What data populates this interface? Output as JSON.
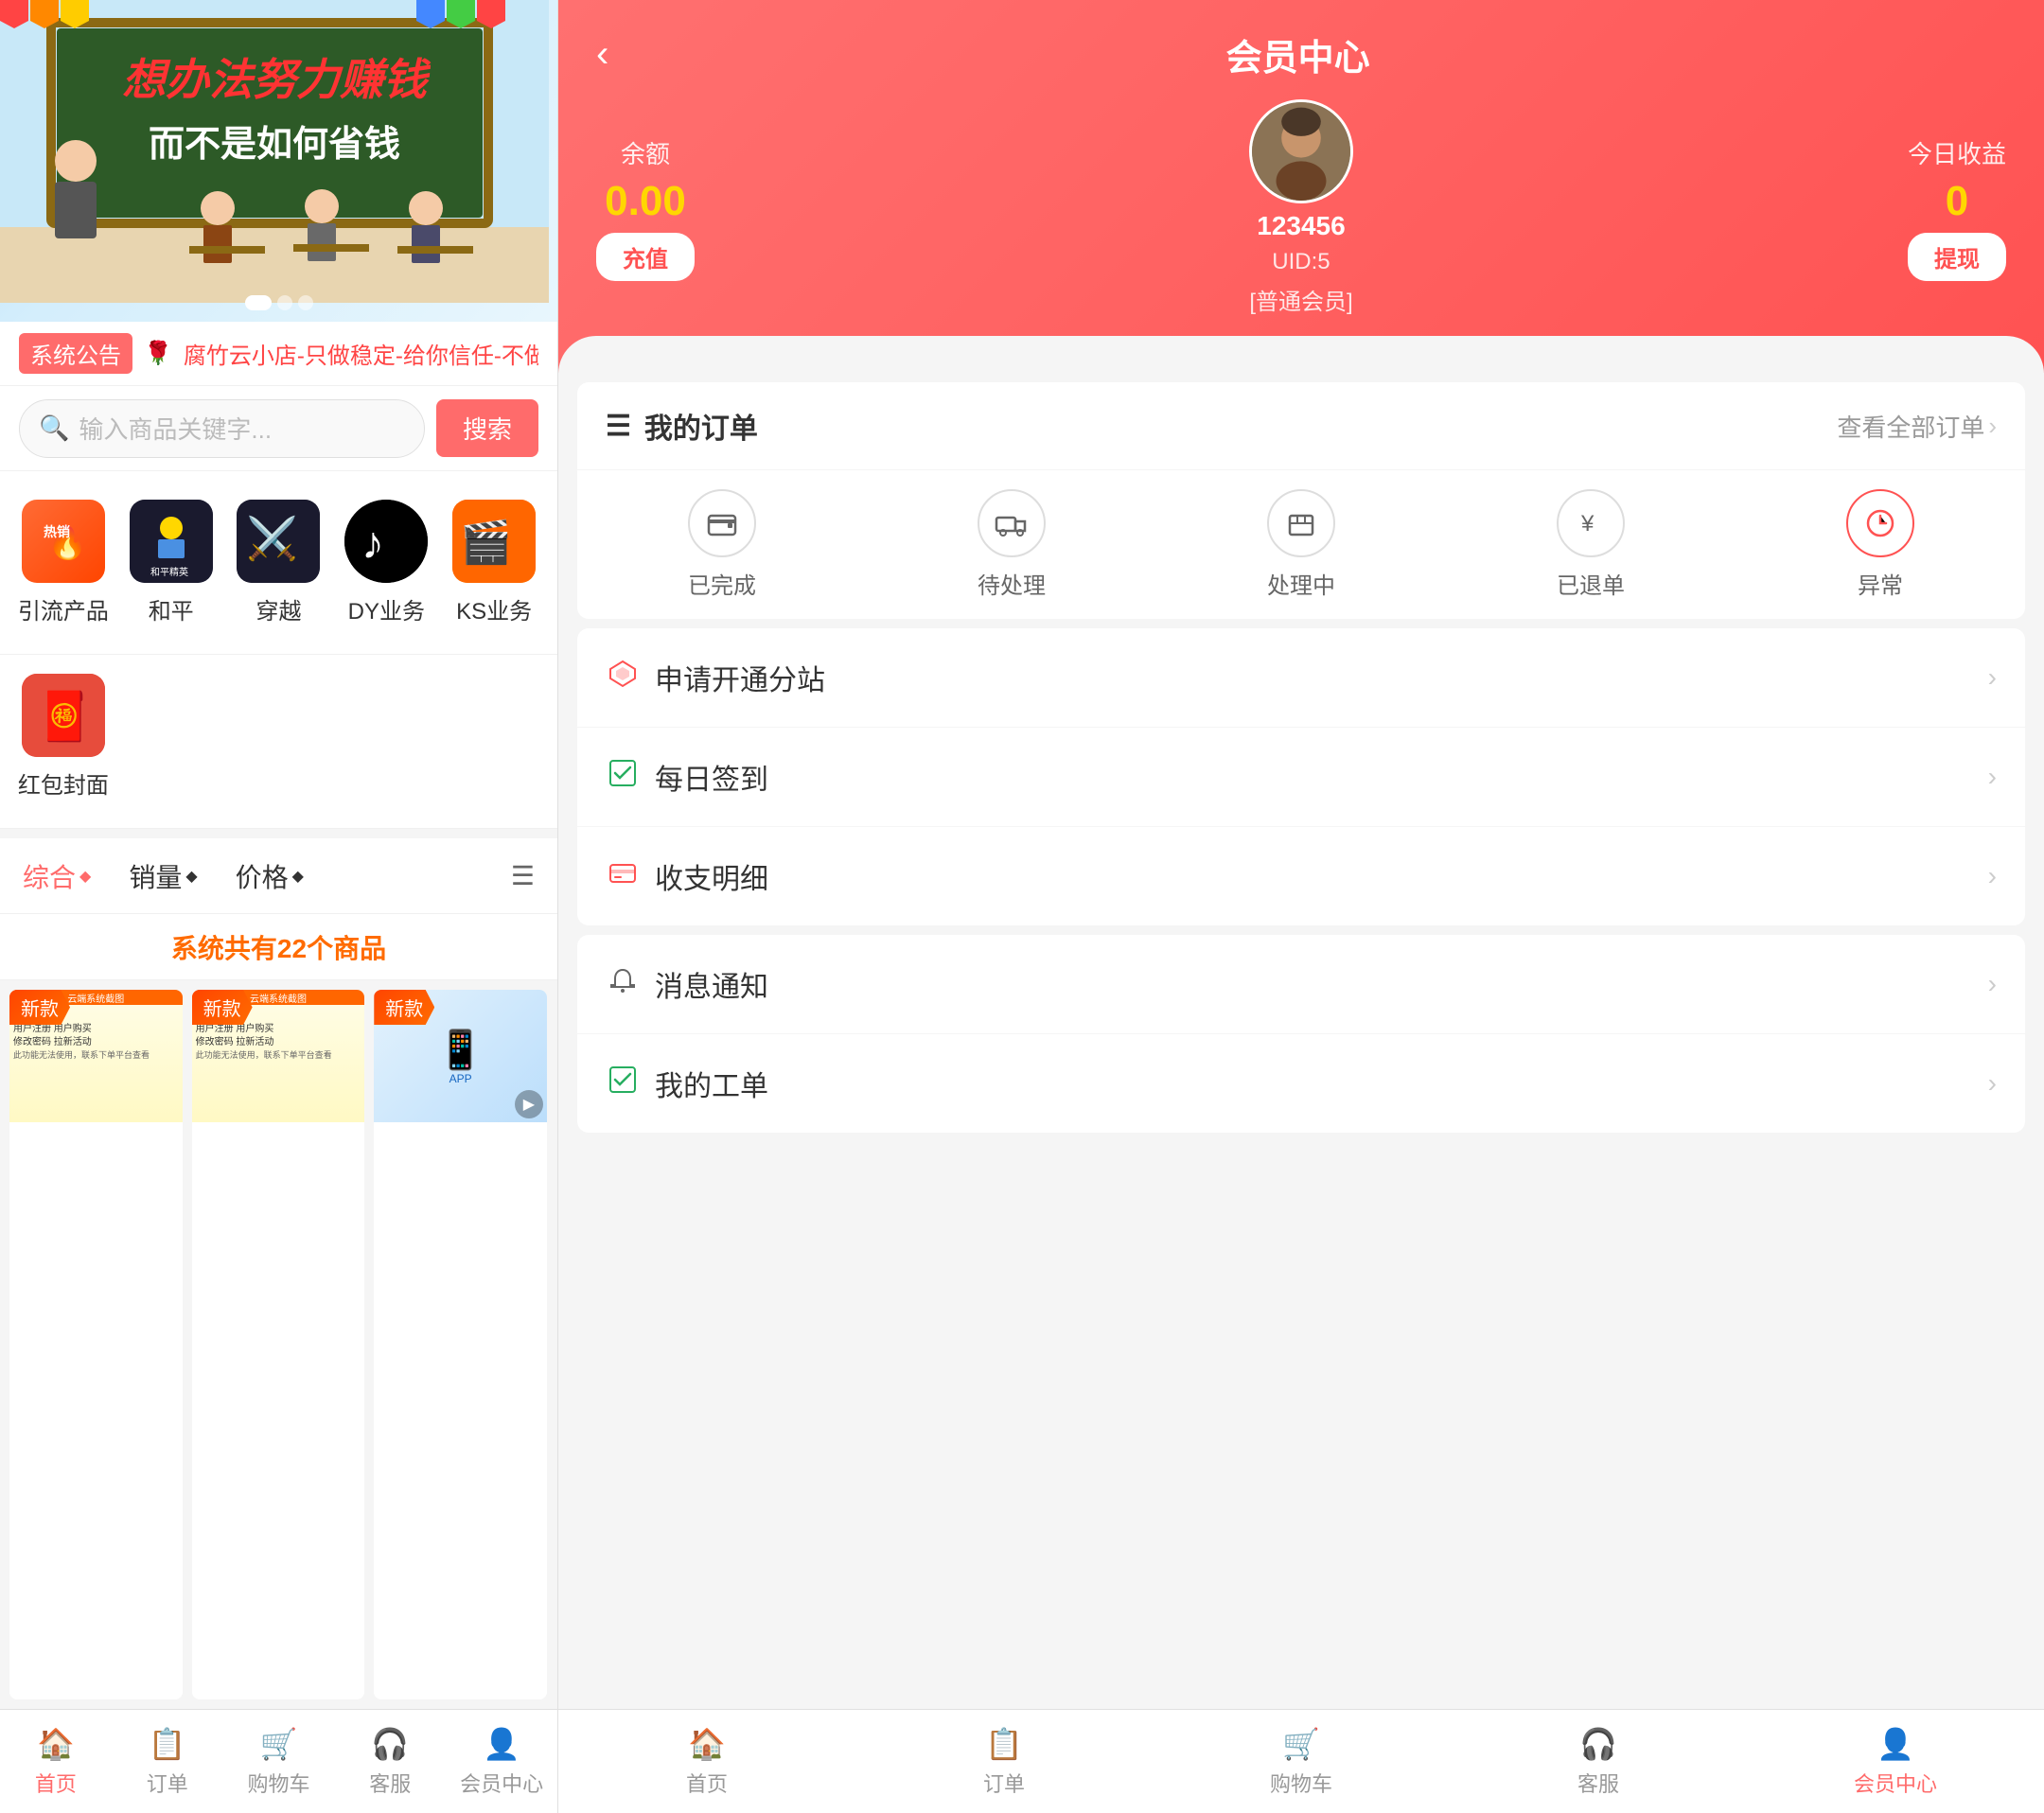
{
  "left": {
    "banner": {
      "text1": "想办法努力赚钱",
      "text2": "而不是如何省钱"
    },
    "notice": {
      "label": "系统公告",
      "text": "🌹腐竹云小店-只做稳定-给你信任-不做跑路狗-售后稳定"
    },
    "search": {
      "placeholder": "输入商品关键字...",
      "button": "搜索"
    },
    "categories": [
      {
        "label": "引流产品",
        "icon": "🔥",
        "bg": "hot"
      },
      {
        "label": "和平",
        "icon": "🎮",
        "bg": "peace"
      },
      {
        "label": "穿越",
        "icon": "⚔️",
        "bg": "cross"
      },
      {
        "label": "DY业务",
        "icon": "♪",
        "bg": "dy"
      },
      {
        "label": "KS业务",
        "icon": "🎬",
        "bg": "ks"
      }
    ],
    "categories2": [
      {
        "label": "红包封面",
        "icon": "🧧",
        "bg": "red"
      }
    ],
    "sort": {
      "items": [
        "综合",
        "销量",
        "价格"
      ],
      "active": "综合",
      "diamond": "◆"
    },
    "products_count": "系统共有22个商品",
    "new_badge": "新款",
    "bottom_nav": [
      {
        "icon": "🏠",
        "label": "首页",
        "active": true
      },
      {
        "icon": "📋",
        "label": "订单",
        "active": false
      },
      {
        "icon": "🛒",
        "label": "购物车",
        "active": false
      },
      {
        "icon": "🎧",
        "label": "客服",
        "active": false
      },
      {
        "icon": "👤",
        "label": "会员中心",
        "active": false
      }
    ]
  },
  "right": {
    "header": {
      "title": "会员中心",
      "back_icon": "‹",
      "balance_label": "余额",
      "balance_amount": "0.00",
      "recharge_btn": "充值",
      "username": "123456",
      "uid": "UID:5",
      "member_type": "[普通会员]",
      "earnings_label": "今日收益",
      "earnings_amount": "0",
      "withdraw_btn": "提现"
    },
    "orders": {
      "title": "我的订单",
      "view_all": "查看全部订单",
      "statuses": [
        {
          "icon": "💳",
          "label": "已完成",
          "type": "wallet"
        },
        {
          "icon": "🚚",
          "label": "待处理",
          "type": "truck"
        },
        {
          "icon": "📦",
          "label": "处理中",
          "type": "box"
        },
        {
          "icon": "¥",
          "label": "已退单",
          "type": "refund"
        },
        {
          "icon": "⏰",
          "label": "异常",
          "type": "clock",
          "active": true
        }
      ]
    },
    "menu_items": [
      {
        "icon": "💎",
        "label": "申请开通分站",
        "icon_type": "diamond"
      },
      {
        "icon": "✅",
        "label": "每日签到",
        "icon_type": "check"
      },
      {
        "icon": "💳",
        "label": "收支明细",
        "icon_type": "card"
      }
    ],
    "menu_items2": [
      {
        "icon": "🔔",
        "label": "消息通知",
        "icon_type": "bell"
      },
      {
        "icon": "✅",
        "label": "我的工单",
        "icon_type": "check"
      }
    ],
    "bottom_nav": [
      {
        "icon": "🏠",
        "label": "首页",
        "active": false
      },
      {
        "icon": "📋",
        "label": "订单",
        "active": false
      },
      {
        "icon": "🛒",
        "label": "购物车",
        "active": false
      },
      {
        "icon": "🎧",
        "label": "客服",
        "active": false
      },
      {
        "icon": "👤",
        "label": "会员中心",
        "active": true
      }
    ]
  }
}
